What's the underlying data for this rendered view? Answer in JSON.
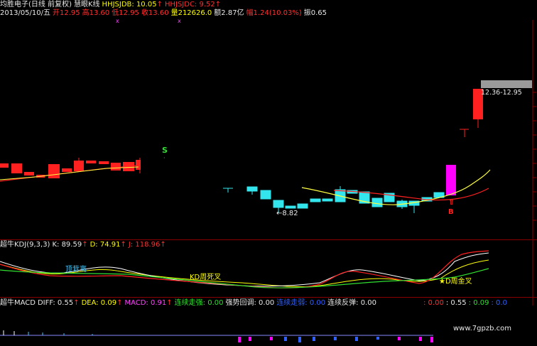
{
  "header": {
    "stock_name": "均胜电子(日线 前复权)",
    "indicator_name": "慧眼K线",
    "hhjsjdb_label": "HHJSJDB: 10.05",
    "hhjsjdb_arrow": "↑",
    "hhjsjdc_label": "HHJSJDC: 9.52",
    "hhjsjdc_arrow": "↑",
    "date": "2013/05/10/五",
    "open": "开12.95",
    "high": "高13.60",
    "low": "低12.95",
    "close": "收13.60",
    "volume": "量212626.0",
    "amount": "额2.87亿",
    "change": "幅1.24(10.03%)",
    "amplitude": "振0.65"
  },
  "main_chart": {
    "s_signal": "S",
    "b_signal": "B",
    "low_annotation": "←8.82",
    "price_range": "12.36-12.95"
  },
  "kdj": {
    "title": "超牛KDJ(9,3,3)",
    "k_label": "K: 89.59",
    "k_arrow": "↑",
    "d_label": "D: 74.91",
    "d_arrow": "↑",
    "j_label": "J: 118.96",
    "j_arrow": "↑",
    "dead_cross_label": "顶背离",
    "kd_dead_cross": "KD周死叉",
    "kd_golden_cross": "★D周金叉"
  },
  "macd": {
    "title": "超牛MACD",
    "diff_label": "DIFF: 0.55",
    "diff_arrow": "↑",
    "dea_label": "DEA: 0.09",
    "dea_arrow": "↑",
    "macd_label": "MACD: 0.91",
    "macd_arrow": "↑",
    "strong_up": "连续走强: 0.00",
    "pullback": "强势回调: 0.00",
    "weak_down": "连续走弱: 0.00",
    "rebound": "连续反弹: 0.00",
    "right_red": ": 0.00",
    "right_white": ": 0.55",
    "right_green": ": 0.09",
    "right_blue": ": 0.0"
  },
  "watermark": "www.7gpzb.com",
  "colors": {
    "up_candle": "#ff2020",
    "down_candle": "#33e6ee",
    "limit_candle": "#ff00ff",
    "ma_yellow": "#ffff40",
    "ma_red": "#ff2020",
    "k_line": "#ffffff",
    "d_line": "#ffff00",
    "j_line": "#ff2020",
    "green_line": "#30e030"
  }
}
